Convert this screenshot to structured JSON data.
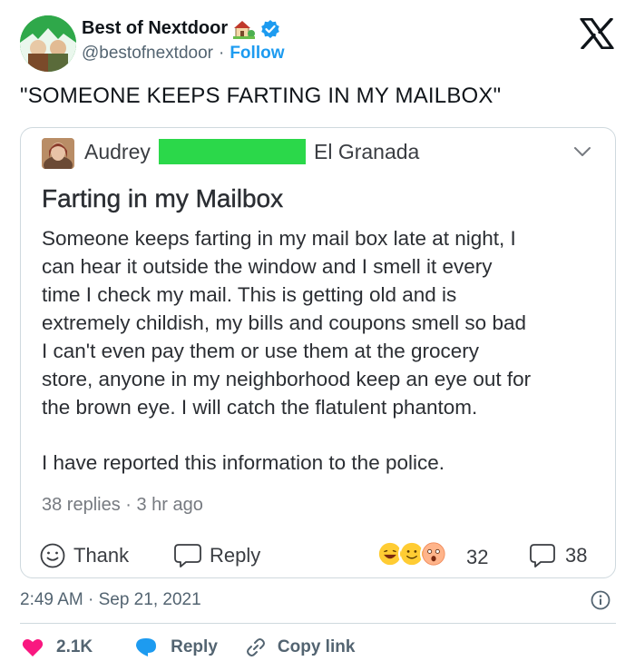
{
  "tweet": {
    "display_name": "Best of Nextdoor",
    "house_emoji": "house-with-garden-emoji",
    "verified_icon": "verified-badge-icon",
    "handle": "@bestofnextdoor",
    "separator": "·",
    "follow_label": "Follow",
    "text": "\"SOMEONE KEEPS FARTING IN MY MAILBOX\"",
    "brand_icon": "x-logo-icon"
  },
  "post": {
    "author": "Audrey",
    "location": "El Granada",
    "title": "Farting in my Mailbox",
    "body_lines": [
      "Someone keeps farting in my mail box late at night, I",
      "can hear it outside the window and I smell it every",
      "time I check my mail. This is getting old and is",
      "extremely childish, my bills and coupons smell so bad",
      "I can't even pay them or use them at the grocery",
      "store, anyone in my neighborhood keep an eye out for",
      "the brown eye. I will catch the flatulent phantom."
    ],
    "police_line": "I have reported this information to the police.",
    "meta": "38 replies · 3 hr ago",
    "thank_label": "Thank",
    "reply_label": "Reply",
    "reaction_count": "32",
    "comment_count": "38"
  },
  "footer": {
    "timestamp": "2:49 AM · Sep 21, 2021",
    "likes": "2.1K",
    "reply_label": "Reply",
    "copy_label": "Copy link"
  },
  "colors": {
    "accent_blue": "#1d9bf0",
    "like_red": "#f91880",
    "redaction_green": "#2bd84a",
    "muted": "#536471",
    "border": "#cfd9de"
  }
}
